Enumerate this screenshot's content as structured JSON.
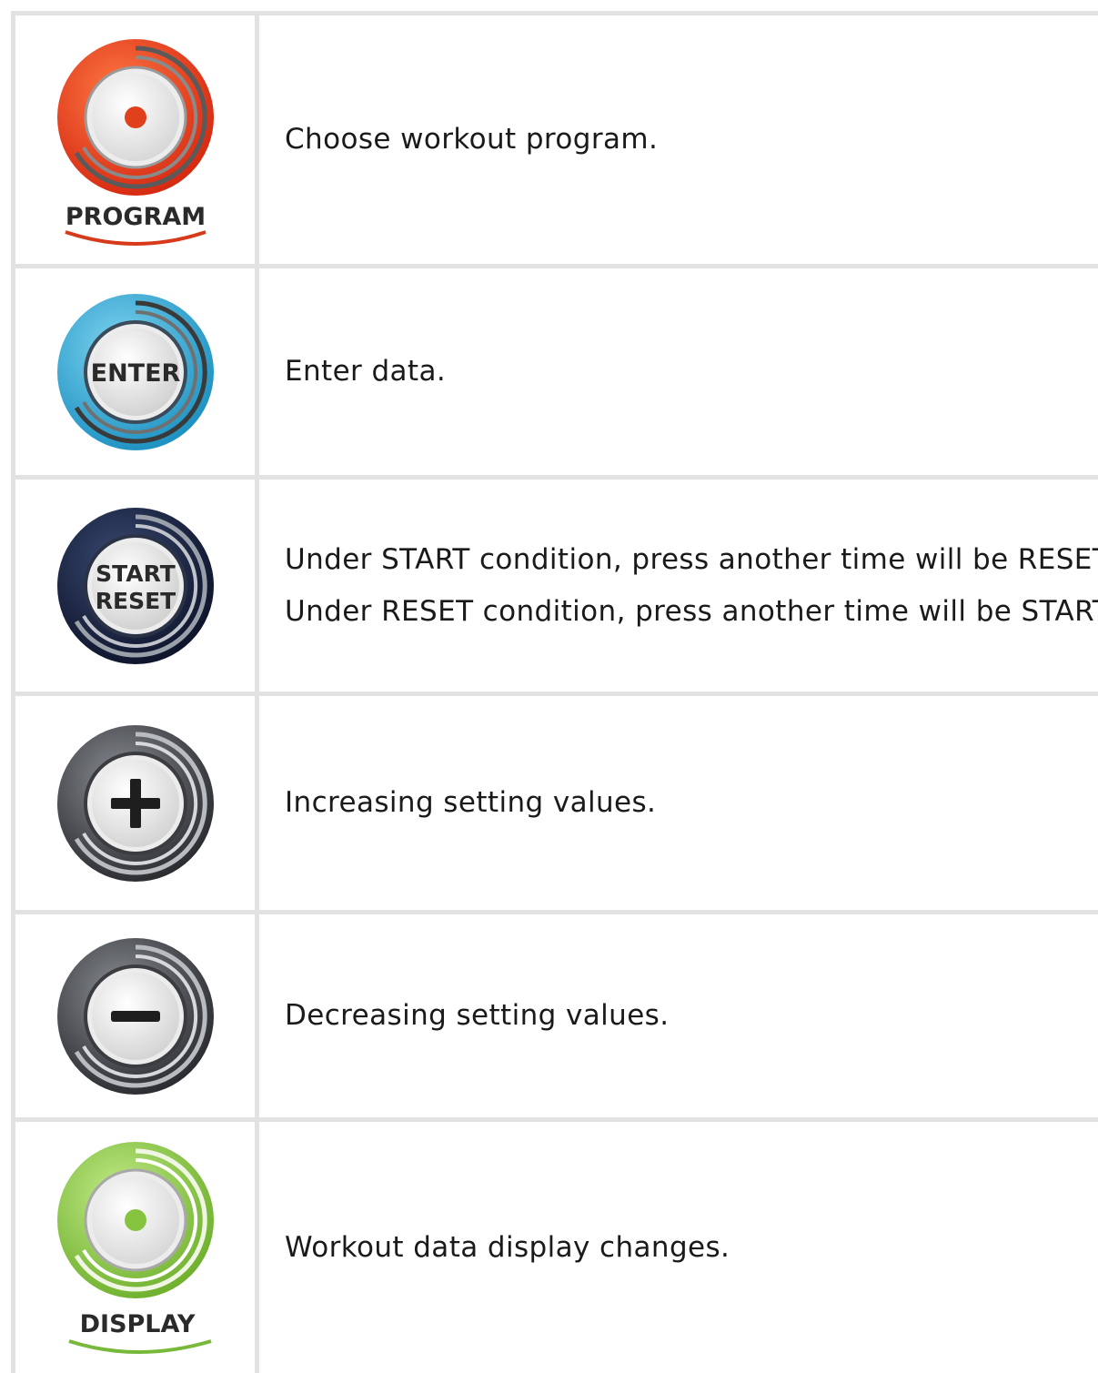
{
  "rows": [
    {
      "icon": "program-button-icon",
      "label": "PROGRAM",
      "accent": "#e0401c",
      "description": [
        "Choose workout program."
      ]
    },
    {
      "icon": "enter-button-icon",
      "label": "ENTER",
      "accent": "#29a9d6",
      "description": [
        "Enter data."
      ]
    },
    {
      "icon": "start-reset-button-icon",
      "label": [
        "START",
        "RESET"
      ],
      "accent": "#121a33",
      "description": [
        "Under START condition, press another time will be RESET.",
        "Under RESET condition, press another time will be START."
      ]
    },
    {
      "icon": "plus-button-icon",
      "accent": "#3a3c40",
      "description": [
        "Increasing setting values."
      ]
    },
    {
      "icon": "minus-button-icon",
      "accent": "#3a3c40",
      "description": [
        "Decreasing setting values."
      ]
    },
    {
      "icon": "display-button-icon",
      "label": "DISPLAY",
      "accent": "#86c440",
      "description": [
        "Workout data display changes."
      ]
    }
  ]
}
